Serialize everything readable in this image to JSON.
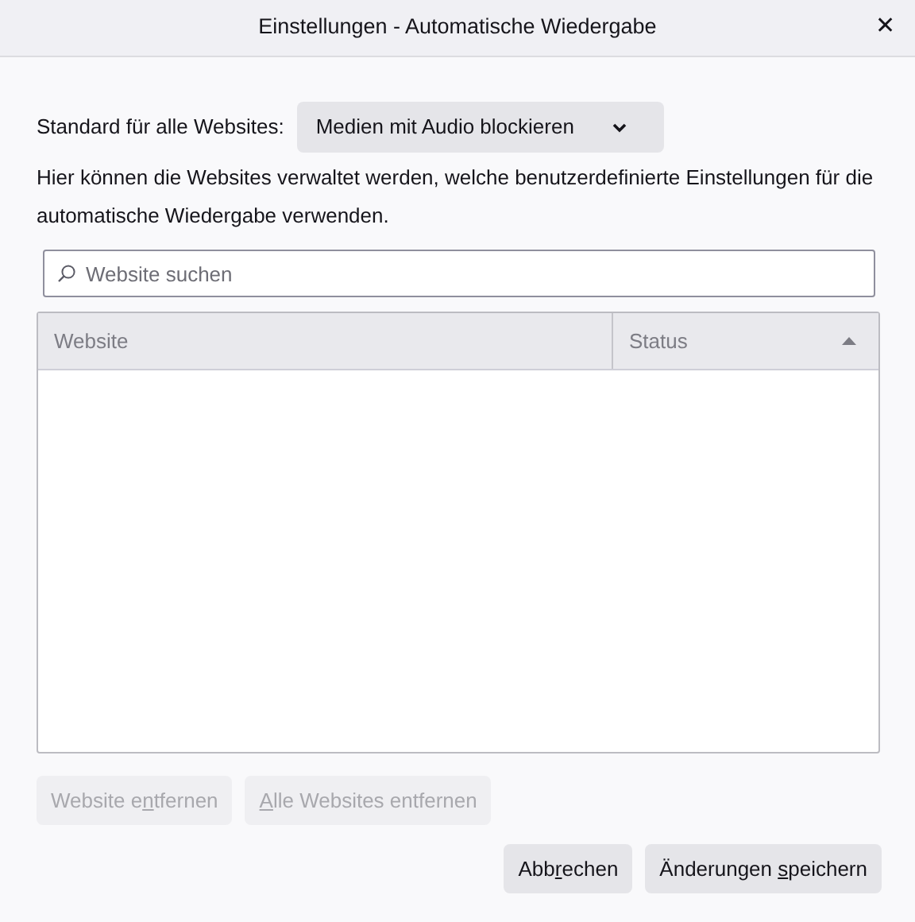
{
  "window": {
    "title": "Einstellungen - Automatische Wiedergabe",
    "close": "✕"
  },
  "default_setting": {
    "label": "Standard für alle Websites:",
    "value": "Medien mit Audio blockieren"
  },
  "description": "Hier können die Websites verwaltet werden, welche benutzerdefinierte Einstellungen für die automatische Wiedergabe verwenden.",
  "search": {
    "placeholder": "Website suchen"
  },
  "table": {
    "columns": [
      {
        "label": "Website",
        "sorted": false
      },
      {
        "label": "Status",
        "sorted": true
      }
    ]
  },
  "list_buttons": [
    {
      "before": "Website e",
      "accesskey": "n",
      "after": "tfernen",
      "disabled": true
    },
    {
      "accesskey": "A",
      "after": "lle Websites entfernen",
      "disabled": true
    }
  ],
  "dialog_buttons": [
    {
      "before": "Abb",
      "accesskey": "r",
      "after": "echen",
      "disabled": false
    },
    {
      "before": "Änderungen ",
      "accesskey": "s",
      "after": "peichern",
      "disabled": false
    }
  ]
}
